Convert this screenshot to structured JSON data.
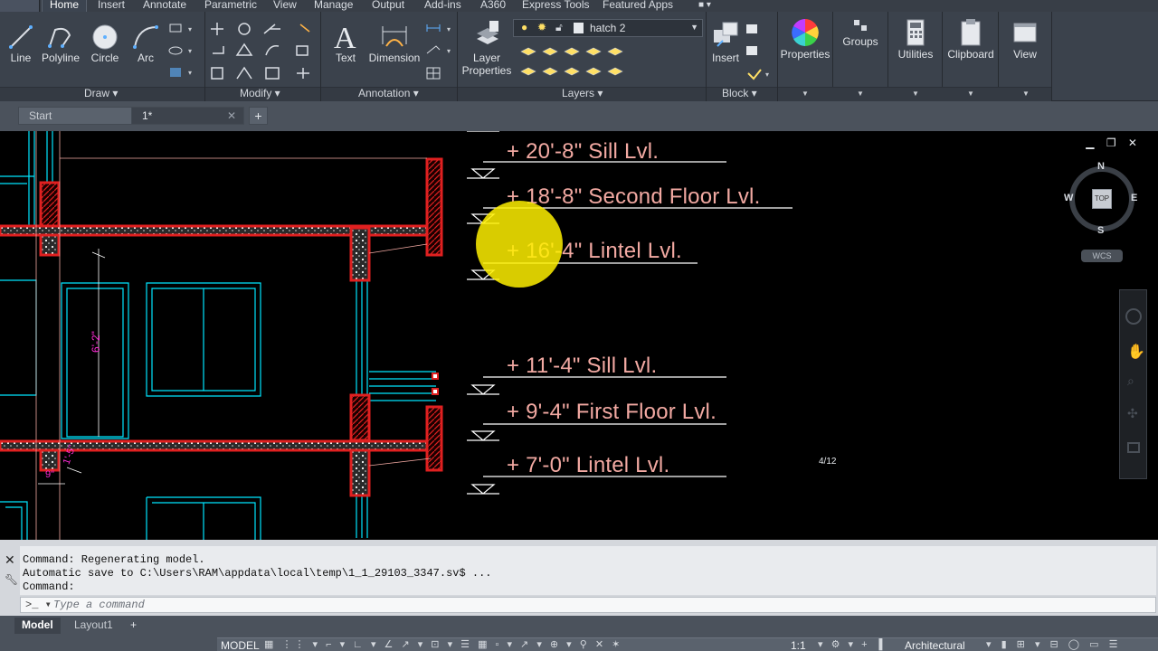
{
  "ribbon_tabs": [
    "Home",
    "Insert",
    "Annotate",
    "Parametric",
    "View",
    "Manage",
    "Output",
    "Add-ins",
    "A360",
    "Express Tools",
    "Featured Apps"
  ],
  "draw_panel": {
    "title": "Draw",
    "line": "Line",
    "polyline": "Polyline",
    "circle": "Circle",
    "arc": "Arc"
  },
  "modify_panel": {
    "title": "Modify"
  },
  "annotation_panel": {
    "title": "Annotation",
    "text": "Text",
    "dimension": "Dimension"
  },
  "layers_panel": {
    "title": "Layers",
    "layer_properties_line1": "Layer",
    "layer_properties_line2": "Properties",
    "current_layer": "hatch 2"
  },
  "block_panel": {
    "title": "Block",
    "insert": "Insert"
  },
  "right_buttons": {
    "properties": "Properties",
    "groups": "Groups",
    "utilities": "Utilities",
    "clipboard": "Clipboard",
    "view": "View"
  },
  "doc_tabs": {
    "start": "Start",
    "current": "1*"
  },
  "viewcube": {
    "n": "N",
    "s": "S",
    "e": "E",
    "w": "W",
    "top": "TOP",
    "wcs": "WCS"
  },
  "levels": [
    "+ 20'-8\" Sill Lvl.",
    "+ 18'-8\" Second Floor Lvl.",
    "+ 16'-4\" Lintel Lvl.",
    "+ 11'-4\" Sill Lvl.",
    "+ 9'-4\" First Floor Lvl.",
    "+ 7'-0\" Lintel Lvl."
  ],
  "drawing_labels": {
    "scale_note": "4/12",
    "dim_height": "6'-2\"",
    "dim_small1": "1'-5\"",
    "dim_small2": "9\""
  },
  "command_history": [
    "Command: Regenerating model.",
    "Automatic save to C:\\Users\\RAM\\appdata\\local\\temp\\1_1_29103_3347.sv$ ...",
    "Command:"
  ],
  "command_placeholder": "Type a command",
  "layout_tabs": {
    "model": "Model",
    "layout1": "Layout1"
  },
  "status": {
    "model": "MODEL",
    "units": "Architectural",
    "scale": "1:1"
  },
  "colors": {
    "wall_red": "#e02020",
    "window_cyan": "#00e5ff",
    "text_pink": "#f2a9a2",
    "dim_magenta": "#ff2bd6",
    "highlight": "#fff000"
  }
}
